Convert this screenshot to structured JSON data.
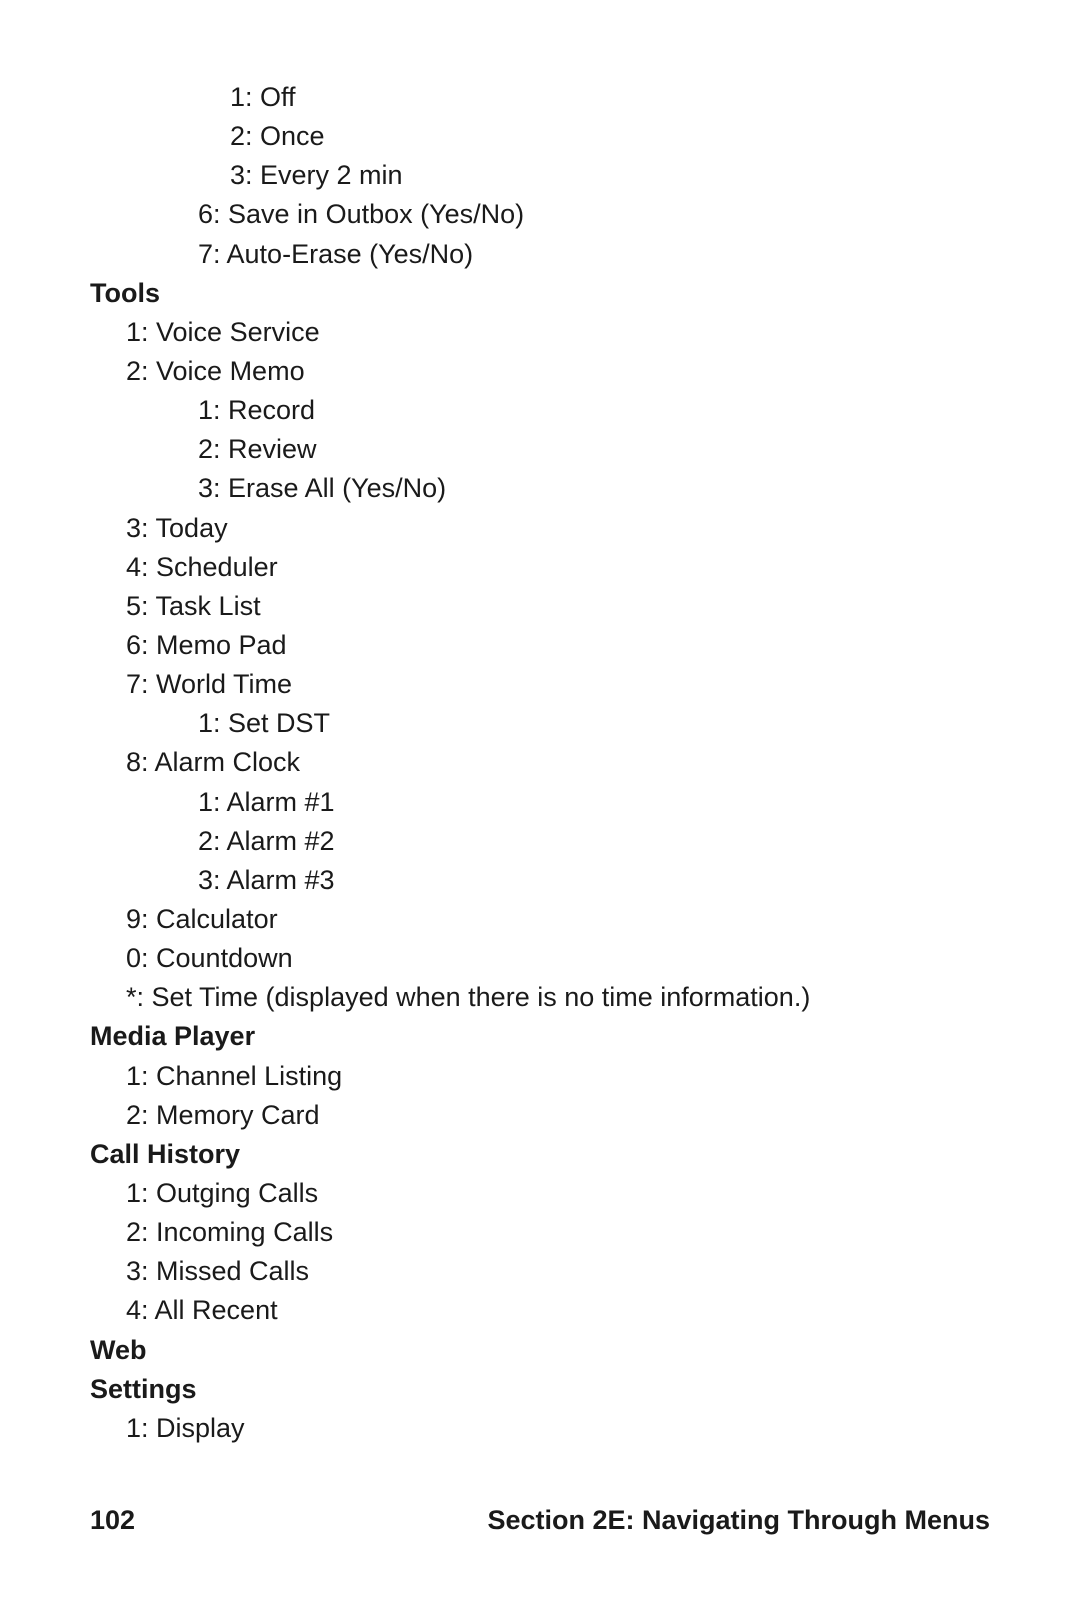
{
  "lines": [
    {
      "lvl": 3,
      "bold": false,
      "text": "1: Off"
    },
    {
      "lvl": 3,
      "bold": false,
      "text": "2: Once"
    },
    {
      "lvl": 3,
      "bold": false,
      "text": "3: Every 2 min"
    },
    {
      "lvl": 2,
      "bold": false,
      "text": "6: Save in Outbox (Yes/No)"
    },
    {
      "lvl": 2,
      "bold": false,
      "text": "7: Auto-Erase (Yes/No)"
    },
    {
      "lvl": 0,
      "bold": true,
      "text": "Tools"
    },
    {
      "lvl": 1,
      "bold": false,
      "text": "1: Voice Service"
    },
    {
      "lvl": 1,
      "bold": false,
      "text": "2: Voice Memo"
    },
    {
      "lvl": 2,
      "bold": false,
      "text": "1: Record"
    },
    {
      "lvl": 2,
      "bold": false,
      "text": "2: Review"
    },
    {
      "lvl": 2,
      "bold": false,
      "text": "3: Erase All (Yes/No)"
    },
    {
      "lvl": 1,
      "bold": false,
      "text": "3: Today"
    },
    {
      "lvl": 1,
      "bold": false,
      "text": "4: Scheduler"
    },
    {
      "lvl": 1,
      "bold": false,
      "text": "5: Task List"
    },
    {
      "lvl": 1,
      "bold": false,
      "text": "6: Memo Pad"
    },
    {
      "lvl": 1,
      "bold": false,
      "text": "7: World Time"
    },
    {
      "lvl": 2,
      "bold": false,
      "text": "1: Set DST"
    },
    {
      "lvl": 1,
      "bold": false,
      "text": "8: Alarm Clock"
    },
    {
      "lvl": 2,
      "bold": false,
      "text": "1: Alarm #1"
    },
    {
      "lvl": 2,
      "bold": false,
      "text": "2: Alarm #2"
    },
    {
      "lvl": 2,
      "bold": false,
      "text": "3: Alarm #3"
    },
    {
      "lvl": 1,
      "bold": false,
      "text": "9: Calculator"
    },
    {
      "lvl": 1,
      "bold": false,
      "text": "0: Countdown"
    },
    {
      "lvl": 1,
      "bold": false,
      "text": "*: Set Time (displayed when there is no time information.)"
    },
    {
      "lvl": 0,
      "bold": true,
      "text": "Media Player"
    },
    {
      "lvl": 1,
      "bold": false,
      "text": "1: Channel Listing"
    },
    {
      "lvl": 1,
      "bold": false,
      "text": "2: Memory Card"
    },
    {
      "lvl": 0,
      "bold": true,
      "text": "Call History"
    },
    {
      "lvl": 1,
      "bold": false,
      "text": "1: Outging Calls"
    },
    {
      "lvl": 1,
      "bold": false,
      "text": "2: Incoming Calls"
    },
    {
      "lvl": 1,
      "bold": false,
      "text": "3: Missed Calls"
    },
    {
      "lvl": 1,
      "bold": false,
      "text": "4: All Recent"
    },
    {
      "lvl": 0,
      "bold": true,
      "text": "Web"
    },
    {
      "lvl": 0,
      "bold": true,
      "text": "Settings"
    },
    {
      "lvl": 1,
      "bold": false,
      "text": "1: Display"
    }
  ],
  "footer": {
    "page_number": "102",
    "section_label": "Section 2E: Navigating Through Menus"
  }
}
